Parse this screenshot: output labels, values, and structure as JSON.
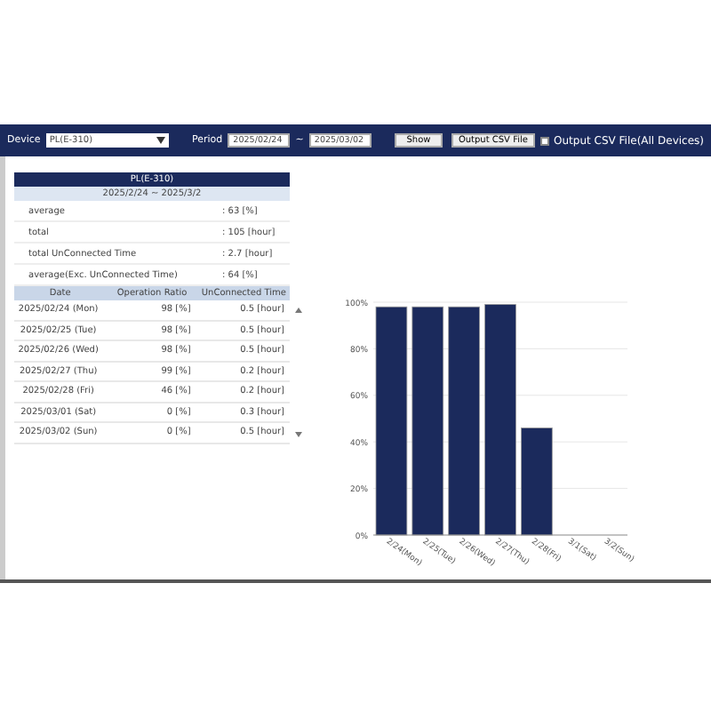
{
  "toolbar": {
    "device_label": "Device",
    "device_value": "PL(E-310)",
    "period_label": "Period",
    "period_from": "2025/02/24",
    "period_sep": "~",
    "period_to": "2025/03/02",
    "show_button": "Show",
    "csv_button": "Output CSV File",
    "all_devices": {
      "label": "Output CSV File(All Devices)",
      "checked": false
    }
  },
  "summary": {
    "title": "PL(E-310)",
    "range": "2025/2/24 ~ 2025/3/2",
    "rows": [
      {
        "label": "average",
        "value": ": 63 [%]"
      },
      {
        "label": "total",
        "value": ": 105 [hour]"
      },
      {
        "label": "total UnConnected Time",
        "value": ": 2.7 [hour]"
      },
      {
        "label": "average(Exc. UnConnected Time)",
        "value": ": 64 [%]"
      }
    ]
  },
  "table": {
    "columns": [
      "Date",
      "Operation Ratio",
      "UnConnected Time"
    ],
    "rows": [
      [
        "2025/02/24 (Mon)",
        "98 [%]",
        "0.5 [hour]"
      ],
      [
        "2025/02/25 (Tue)",
        "98 [%]",
        "0.5 [hour]"
      ],
      [
        "2025/02/26 (Wed)",
        "98 [%]",
        "0.5 [hour]"
      ],
      [
        "2025/02/27 (Thu)",
        "99 [%]",
        "0.2 [hour]"
      ],
      [
        "2025/02/28 (Fri)",
        "46 [%]",
        "0.2 [hour]"
      ],
      [
        "2025/03/01 (Sat)",
        "0 [%]",
        "0.3 [hour]"
      ],
      [
        "2025/03/02 (Sun)",
        "0 [%]",
        "0.5 [hour]"
      ]
    ]
  },
  "chart_data": {
    "type": "bar",
    "categories": [
      "2/24(Mon)",
      "2/25(Tue)",
      "2/26(Wed)",
      "2/27(Thu)",
      "2/28(Fri)",
      "3/1(Sat)",
      "3/2(Sun)"
    ],
    "series": [
      {
        "color": "#1b2a5c",
        "values": [
          98,
          98,
          98,
          99,
          46,
          0,
          0
        ]
      }
    ],
    "grid": true,
    "ylim": [
      0,
      100
    ],
    "yticks": [
      {
        "value": 0,
        "label": "0%"
      },
      {
        "value": 20,
        "label": "20%"
      },
      {
        "value": 40,
        "label": "40%"
      },
      {
        "value": 60,
        "label": "60%"
      },
      {
        "value": 80,
        "label": "80%"
      },
      {
        "value": 100,
        "label": "100%"
      }
    ]
  }
}
